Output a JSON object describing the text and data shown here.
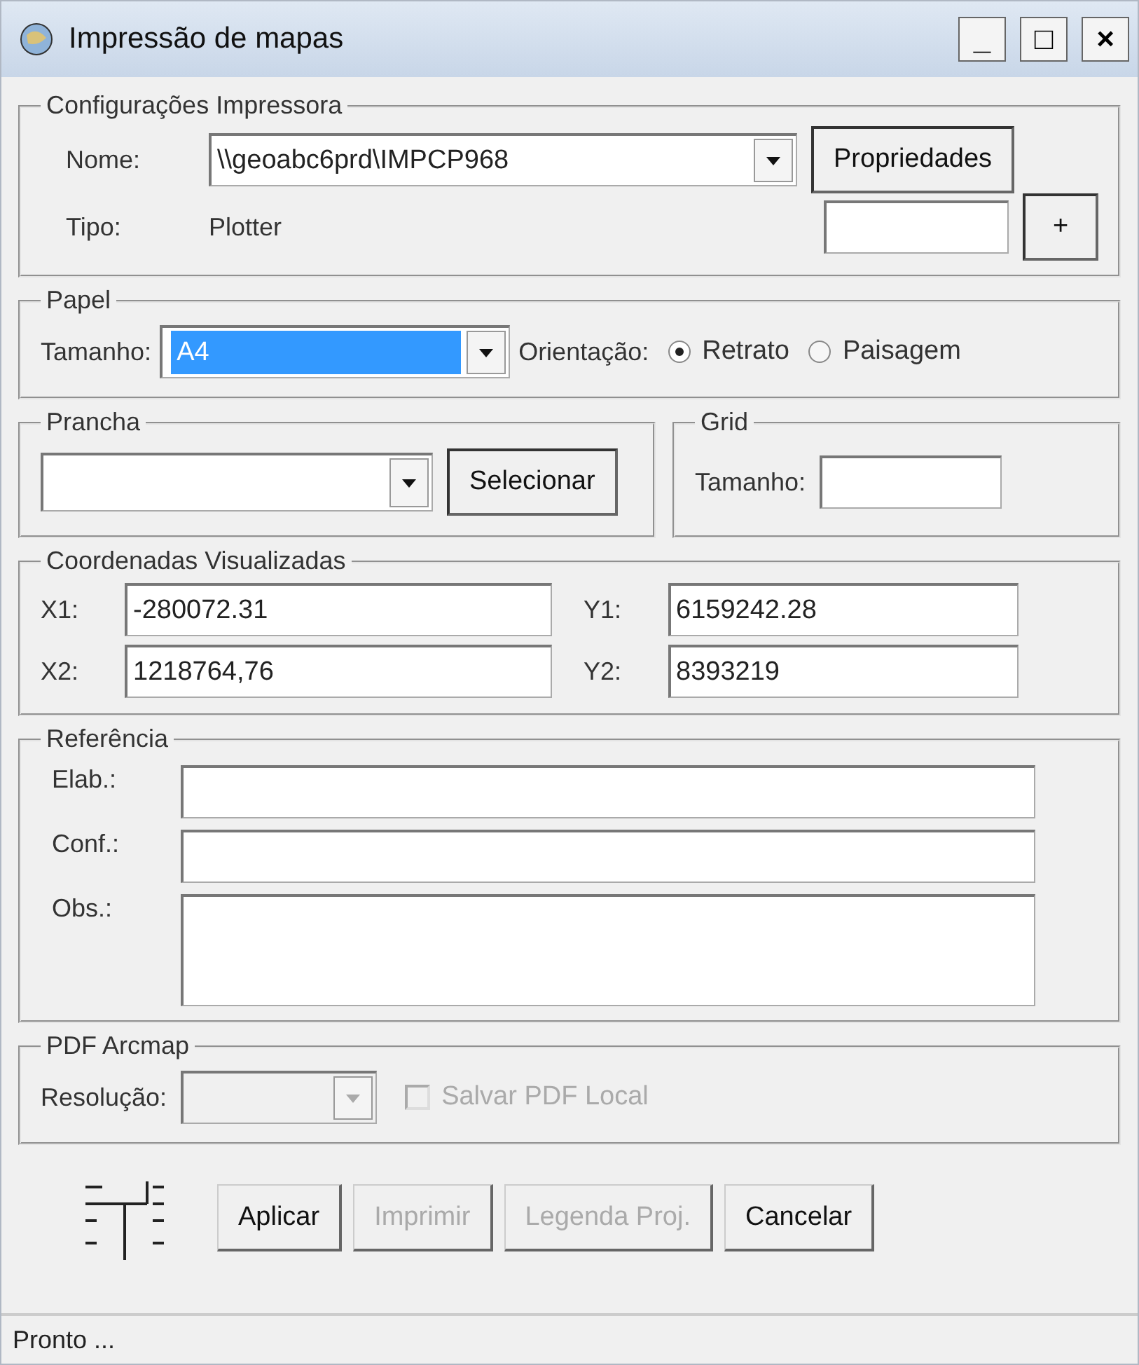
{
  "window": {
    "title": "Impressão de mapas",
    "controls": [
      "_",
      "□",
      "×"
    ]
  },
  "printer": {
    "legend": "Configurações Impressora",
    "name_label": "Nome:",
    "name_value": "\\\\geoabc6prd\\IMPCP968",
    "properties_button": "Propriedades",
    "type_label": "Tipo:",
    "type_value": "Plotter",
    "plus_button": "+"
  },
  "paper": {
    "legend": "Papel",
    "size_label": "Tamanho:",
    "size_value": "A4",
    "size_selected": true,
    "orientation_label": "Orientação:",
    "orientations": [
      {
        "label": "Retrato",
        "selected": true
      },
      {
        "label": "Paisagem",
        "selected": false
      }
    ]
  },
  "sheet": {
    "legend": "Prancha",
    "select_button": "Selecionar"
  },
  "grid": {
    "legend": "Grid",
    "size_label": "Tamanho:"
  },
  "coordinates": {
    "legend": "Coordenadas Visualizadas",
    "fields": [
      {
        "label": "X1:",
        "value": "-280072.31"
      },
      {
        "label": "Y1:",
        "value": "6159242.28"
      },
      {
        "label": "X2:",
        "value": "1218764,76"
      },
      {
        "label": "Y2:",
        "value": "8393219"
      }
    ]
  },
  "reference": {
    "legend": "Referência",
    "fields": [
      {
        "label": "Elab.:",
        "kind": "line"
      },
      {
        "label": "Conf.:",
        "kind": "line"
      },
      {
        "label": "Obs.:",
        "kind": "area"
      }
    ]
  },
  "pdf": {
    "legend": "PDF Arcmap",
    "resolution_label": "Resolução:",
    "disabled": true,
    "save_local": {
      "label": "Salvar PDF Local",
      "checked": false,
      "disabled": true
    }
  },
  "buttons": [
    {
      "label": "Aplicar",
      "disabled": false
    },
    {
      "label": "Imprimir",
      "disabled": true
    },
    {
      "label": "Legenda Proj.",
      "disabled": true
    },
    {
      "label": "Cancelar",
      "disabled": false
    }
  ],
  "status_bar": "Pronto ..."
}
